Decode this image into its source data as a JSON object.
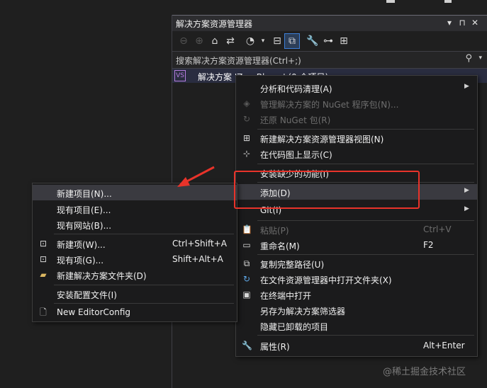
{
  "solution_explorer": {
    "title": "解决方案资源管理器",
    "title_buttons": [
      "▾",
      "⊓",
      "✕"
    ],
    "search_placeholder": "搜索解决方案资源管理器(Ctrl+;)",
    "solution_row": "解决方案 'ZeroBlazor' (0 个项目)"
  },
  "context_menu": {
    "items": [
      {
        "label": "分析和代码清理(A)",
        "shortcut": "",
        "submenu": true,
        "disabled": false,
        "icon": ""
      },
      {
        "label": "管理解决方案的 NuGet 程序包(N)...",
        "shortcut": "",
        "submenu": false,
        "disabled": true,
        "icon": "nuget-icon"
      },
      {
        "label": "还原 NuGet 包(R)",
        "shortcut": "",
        "submenu": false,
        "disabled": true,
        "icon": "restore-icon"
      },
      {
        "label": "新建解决方案资源管理器视图(N)",
        "shortcut": "",
        "submenu": false,
        "disabled": false,
        "icon": "new-view-icon"
      },
      {
        "label": "在代码图上显示(C)",
        "shortcut": "",
        "submenu": false,
        "disabled": false,
        "icon": "code-map-icon"
      },
      {
        "label": "安装缺少的功能(I)",
        "shortcut": "",
        "submenu": false,
        "disabled": false,
        "icon": ""
      },
      {
        "label": "添加(D)",
        "shortcut": "",
        "submenu": true,
        "disabled": false,
        "icon": ""
      },
      {
        "label": "Git(I)",
        "shortcut": "",
        "submenu": true,
        "disabled": false,
        "icon": ""
      },
      {
        "label": "粘贴(P)",
        "shortcut": "Ctrl+V",
        "submenu": false,
        "disabled": true,
        "icon": "paste-icon"
      },
      {
        "label": "重命名(M)",
        "shortcut": "F2",
        "submenu": false,
        "disabled": false,
        "icon": "rename-icon"
      },
      {
        "label": "复制完整路径(U)",
        "shortcut": "",
        "submenu": false,
        "disabled": false,
        "icon": "copy-path-icon"
      },
      {
        "label": "在文件资源管理器中打开文件夹(X)",
        "shortcut": "",
        "submenu": false,
        "disabled": false,
        "icon": "open-folder-icon"
      },
      {
        "label": "在终端中打开",
        "shortcut": "",
        "submenu": false,
        "disabled": false,
        "icon": "terminal-icon"
      },
      {
        "label": "另存为解决方案筛选器",
        "shortcut": "",
        "submenu": false,
        "disabled": false,
        "icon": ""
      },
      {
        "label": "隐藏已卸载的项目",
        "shortcut": "",
        "submenu": false,
        "disabled": false,
        "icon": ""
      },
      {
        "label": "属性(R)",
        "shortcut": "Alt+Enter",
        "submenu": false,
        "disabled": false,
        "icon": "wrench-icon"
      }
    ]
  },
  "add_submenu": {
    "items": [
      {
        "label": "新建项目(N)...",
        "shortcut": "",
        "icon": ""
      },
      {
        "label": "现有项目(E)...",
        "shortcut": "",
        "icon": ""
      },
      {
        "label": "现有网站(B)...",
        "shortcut": "",
        "icon": ""
      },
      {
        "label": "新建项(W)...",
        "shortcut": "Ctrl+Shift+A",
        "icon": "new-item-icon"
      },
      {
        "label": "现有项(G)...",
        "shortcut": "Shift+Alt+A",
        "icon": "existing-item-icon"
      },
      {
        "label": "新建解决方案文件夹(D)",
        "shortcut": "",
        "icon": "folder-icon"
      },
      {
        "label": "安装配置文件(I)",
        "shortcut": "",
        "icon": ""
      },
      {
        "label": "New EditorConfig",
        "shortcut": "",
        "icon": "file-icon"
      }
    ]
  },
  "watermark": "@稀土掘金技术社区",
  "colors": {
    "highlight_box": "#e8332a",
    "selection": "#3d7fd9",
    "background": "#1f1f1f"
  }
}
